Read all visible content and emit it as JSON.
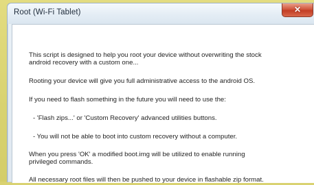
{
  "window": {
    "title": "Root (Wi-Fi Tablet)",
    "close_glyph": "✕"
  },
  "message": {
    "lines": [
      "This script is designed to help you root your device without overwriting the stock",
      "android recovery with a custom one...",
      "Rooting your device will give you full administrative access to the android OS.",
      "If you need to flash something in the future you will need to use the:",
      "- 'Flash zips...' or 'Custom Recovery' advanced utilities buttons.",
      "- You will not be able to boot into custom recovery without a computer.",
      "When you press 'OK' a modified boot.img will be utilized to enable running",
      "privileged commands.",
      "All necessary root files will then be pushed to your device in flashable zip format."
    ]
  },
  "colors": {
    "desktop_background": "#d9d271",
    "close_button": "#c94a31",
    "client_background": "#ffffff"
  },
  "icons": {
    "close": "close-icon"
  }
}
